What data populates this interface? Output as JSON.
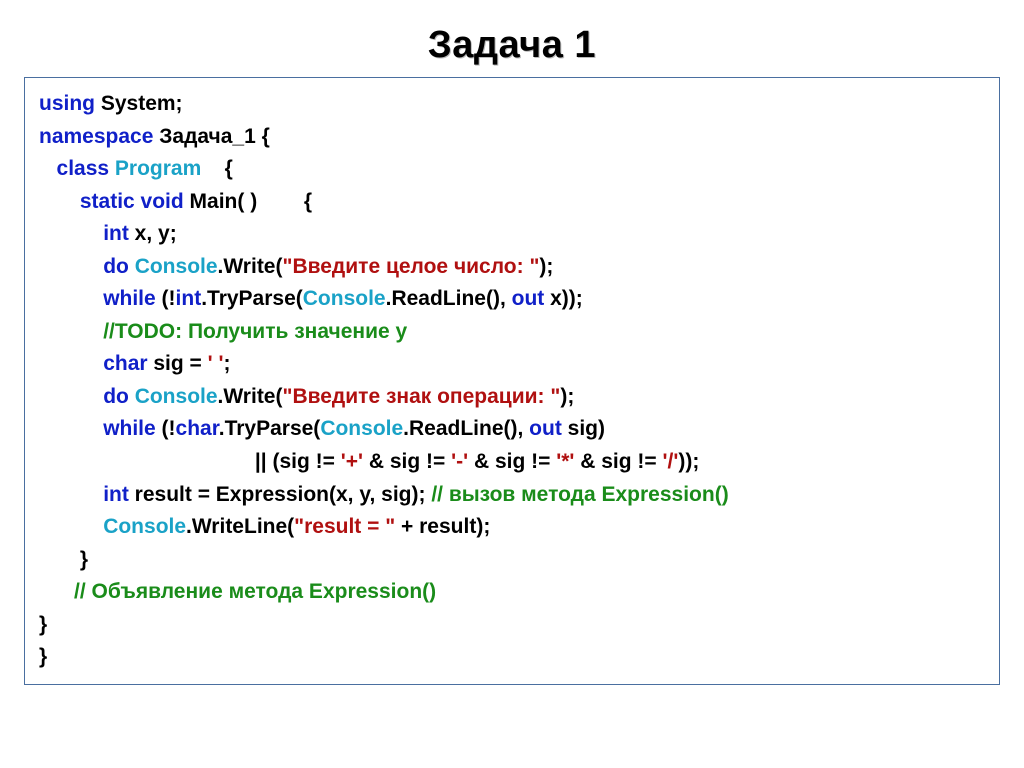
{
  "slide": {
    "title": "Задача 1",
    "code": {
      "l1": {
        "kw1": "using",
        "t1": " System;"
      },
      "l2": {
        "kw1": "namespace",
        "t1": " Задача_1 {"
      },
      "l3": {
        "indent": "   ",
        "kw1": "class",
        "sp": " ",
        "type1": "Program",
        "t1": "    {"
      },
      "l4": {
        "indent": "       ",
        "kw1": "static",
        "sp1": " ",
        "kw2": "void",
        "t1": " Main( )        {"
      },
      "l5": {
        "indent": "           ",
        "kw1": "int",
        "t1": " x, y;"
      },
      "l6": {
        "indent": "           ",
        "kw1": "do",
        "sp": " ",
        "type1": "Console",
        "t1": ".Write(",
        "str1": "\"Введите целое число: \"",
        "t2": ");"
      },
      "l7": {
        "indent": "           ",
        "kw1": "while",
        "t1": " (!",
        "kw2": "int",
        "t2": ".TryParse(",
        "type1": "Console",
        "t3": ".ReadLine(), ",
        "kw3": "out",
        "t4": " x));"
      },
      "l8": {
        "indent": "           ",
        "com": "//TODO: Получить значение y"
      },
      "l9": {
        "indent": "           ",
        "kw1": "char",
        "t1": " sig = ",
        "str1": "' '",
        "t2": ";"
      },
      "l10": {
        "indent": "           ",
        "kw1": "do",
        "sp": " ",
        "type1": "Console",
        "t1": ".Write(",
        "str1": "\"Введите знак операции: \"",
        "t2": "); "
      },
      "l11": {
        "indent": "           ",
        "kw1": "while",
        "t1": " (!",
        "kw2": "char",
        "t2": ".TryParse(",
        "type1": "Console",
        "t3": ".ReadLine(), ",
        "kw3": "out",
        "t4": " sig) "
      },
      "l12": {
        "indent": "                                     ",
        "t1": "|| (sig != ",
        "str1": "'+'",
        "t2": " & sig != ",
        "str2": "'-'",
        "t3": " & sig != ",
        "str3": "'*'",
        "t4": " & sig != ",
        "str4": "'/'",
        "t5": "));"
      },
      "l13": {
        "indent": "           ",
        "kw1": "int",
        "t1": " result = Expression(x, y, sig); ",
        "com": "// вызов метода Expression()"
      },
      "l14": {
        "indent": "           ",
        "type1": "Console",
        "t1": ".WriteLine(",
        "str1": "\"result = \"",
        "t2": " + result);"
      },
      "l15": {
        "indent": "       ",
        "t1": "}"
      },
      "l16": {
        "indent": "      ",
        "com": "// Объявление метода Expression()"
      },
      "l17": {
        "t1": "}"
      },
      "l18": {
        "t1": "}"
      }
    }
  }
}
